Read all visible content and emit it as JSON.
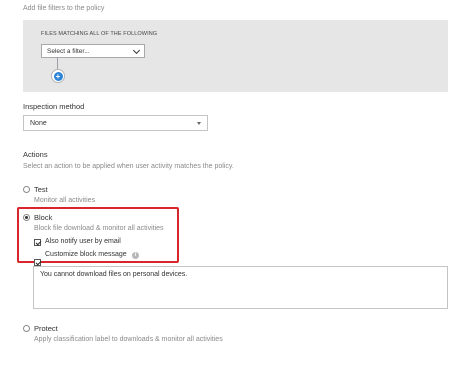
{
  "filters": {
    "heading": "Add file filters to the policy",
    "matching_label": "FILES MATCHING ALL OF THE FOLLOWING",
    "select_placeholder": "Select a filter...",
    "add_icon": "plus-icon"
  },
  "inspection": {
    "label": "Inspection method",
    "value": "None"
  },
  "actions": {
    "label": "Actions",
    "description": "Select an action to be applied when user activity matches the policy.",
    "test": {
      "title": "Test",
      "description": "Monitor all activities"
    },
    "block": {
      "title": "Block",
      "description": "Block file download & monitor all activities",
      "notify_label": "Also notify user by email",
      "customize_label": "Customize block message",
      "message": "You cannot download files on personal devices."
    },
    "protect": {
      "title": "Protect",
      "description": "Apply classification label to downloads & monitor all activities"
    }
  },
  "colors": {
    "highlight": "#d9262d",
    "accent": "#2b84d6"
  }
}
